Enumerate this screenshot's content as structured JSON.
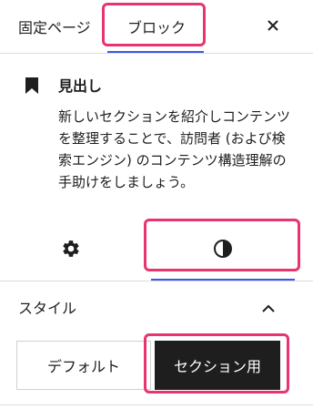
{
  "tabs": {
    "page_label": "固定ページ",
    "block_label": "ブロック"
  },
  "block": {
    "title": "見出し",
    "description": "新しいセクションを紹介しコンテンツを整理することで、訪問者 (および検索エンジン) のコンテンツ構造理解の手助けをしましょう。"
  },
  "panel_tabs": {
    "settings_icon": "gear-icon",
    "styles_icon": "contrast-icon"
  },
  "styles": {
    "heading": "スタイル",
    "options": [
      "デフォルト",
      "セクション用"
    ],
    "selected": "セクション用"
  },
  "colors": {
    "accent": "#3858e9",
    "highlight": "#e8356d",
    "selected_bg": "#1e1e1e"
  }
}
